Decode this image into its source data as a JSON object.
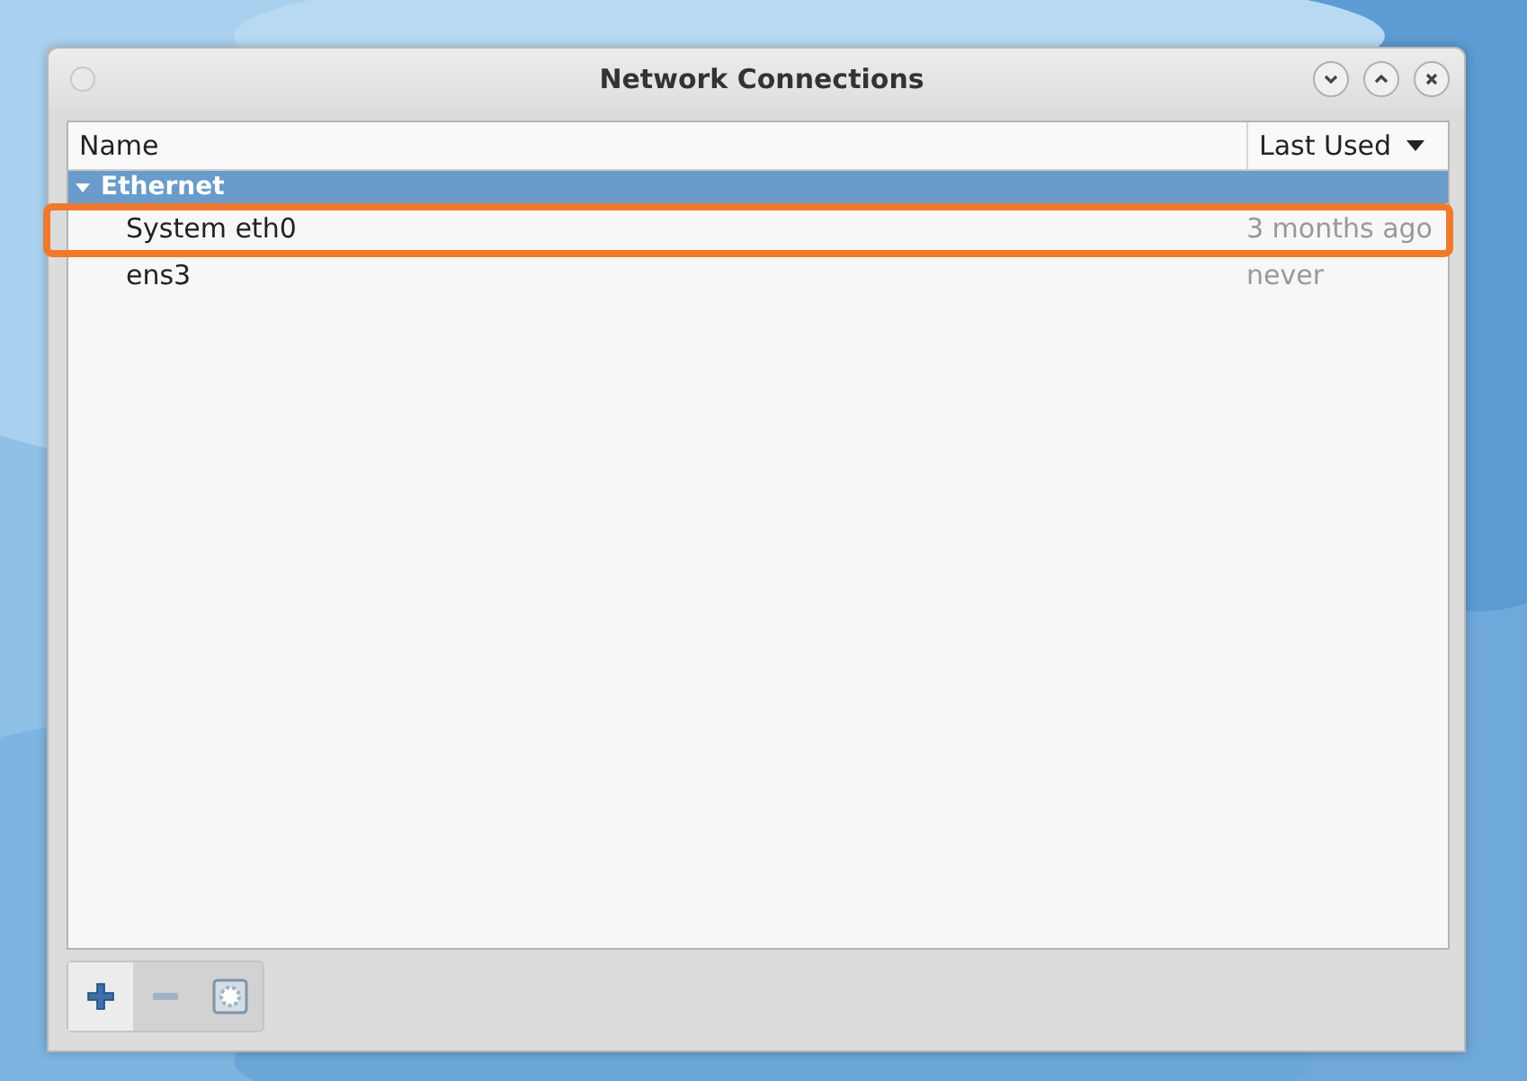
{
  "window": {
    "title": "Network Connections"
  },
  "table": {
    "columns": [
      {
        "label": "Name",
        "sorted": false
      },
      {
        "label": "Last Used",
        "sorted": true
      }
    ],
    "groups": [
      {
        "label": "Ethernet",
        "selected": true,
        "expanded": true,
        "children": [
          {
            "name": "System eth0",
            "last_used": "3 months ago",
            "highlighted": true
          },
          {
            "name": "ens3",
            "last_used": "never",
            "highlighted": false
          }
        ]
      }
    ]
  },
  "toolbar": [
    {
      "kind": "add",
      "disabled": false
    },
    {
      "kind": "remove",
      "disabled": true
    },
    {
      "kind": "settings",
      "disabled": true
    }
  ]
}
